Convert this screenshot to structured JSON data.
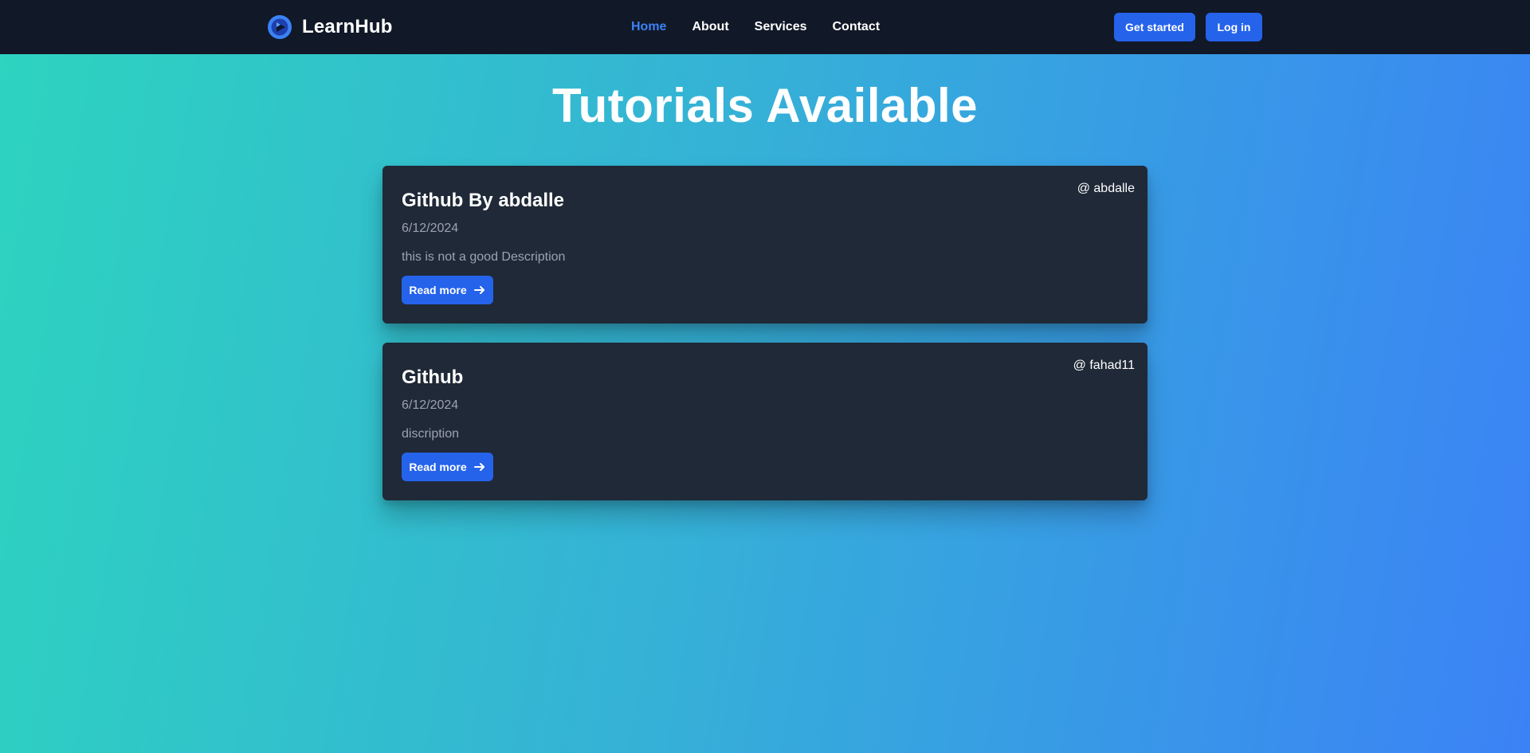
{
  "brand": {
    "name": "LearnHub",
    "logo_icon": "play-circle-icon"
  },
  "nav": {
    "links": [
      {
        "label": "Home",
        "active": true
      },
      {
        "label": "About",
        "active": false
      },
      {
        "label": "Services",
        "active": false
      },
      {
        "label": "Contact",
        "active": false
      }
    ],
    "get_started": "Get started",
    "login": "Log in"
  },
  "page": {
    "title": "Tutorials Available"
  },
  "tutorials": [
    {
      "title": "Github By abdalle",
      "author": "@ abdalle",
      "date": "6/12/2024",
      "description": "this is not a good Description",
      "button": "Read more"
    },
    {
      "title": "Github",
      "author": "@ fahad11",
      "date": "6/12/2024",
      "description": "discription",
      "button": "Read more"
    }
  ],
  "colors": {
    "accent": "#2563eb",
    "nav_bg": "#111827",
    "card_bg": "#1f2937",
    "active_link": "#3b82f6",
    "gradient_start": "#2dd4bf",
    "gradient_end": "#3b82f6"
  }
}
